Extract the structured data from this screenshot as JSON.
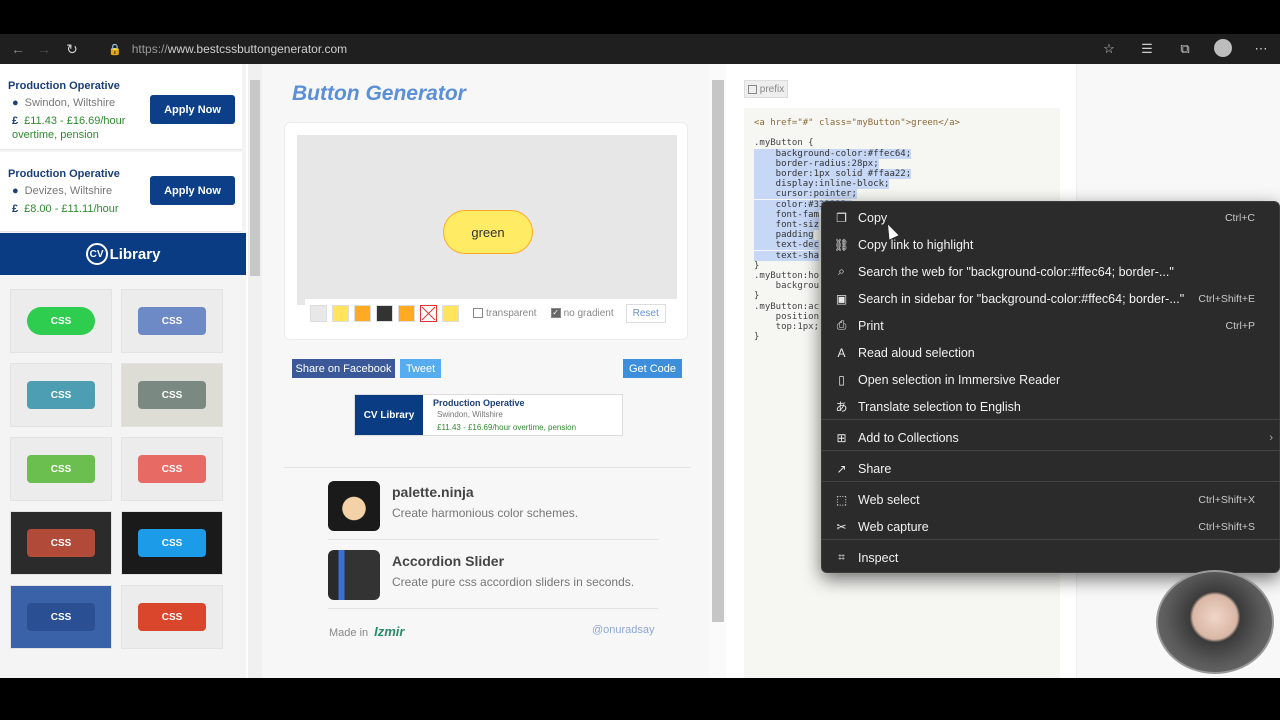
{
  "browser": {
    "url_protocol": "https://",
    "url_host": "www.bestcssbuttongenerator.com"
  },
  "left_ads": {
    "jobs": [
      {
        "title": "Production Operative",
        "location": "Swindon, Wiltshire",
        "pay": "£11.43 - £16.69/hour overtime, pension",
        "button": "Apply Now"
      },
      {
        "title": "Production Operative",
        "location": "Devizes, Wiltshire",
        "pay": "£8.00 - £11.11/hour",
        "button": "Apply Now"
      }
    ],
    "brand": "Library",
    "brand_mark": "CV",
    "swatches": [
      {
        "label": "CSS",
        "bg": "#2ecc4f",
        "tile": "#ececec"
      },
      {
        "label": "CSS",
        "bg": "#6d89c6",
        "tile": "#ececec"
      },
      {
        "label": "CSS",
        "bg": "#4e9eb3",
        "tile": "#ececec"
      },
      {
        "label": "CSS",
        "bg": "#7a8a82",
        "tile": "#ddddd5"
      },
      {
        "label": "CSS",
        "bg": "#6bbf4e",
        "tile": "#ececec"
      },
      {
        "label": "CSS",
        "bg": "#e86a64",
        "tile": "#ececec"
      },
      {
        "label": "CSS",
        "bg": "#b24a3a",
        "tile": "#2b2b2b"
      },
      {
        "label": "CSS",
        "bg": "#1c9ce8",
        "tile": "#1a1a1a"
      },
      {
        "label": "CSS",
        "bg": "#2b4f93",
        "tile": "#3a62a8"
      },
      {
        "label": "CSS",
        "bg": "#d9462b",
        "tile": "#ececec"
      }
    ]
  },
  "generator": {
    "title": "Button Generator",
    "preview_button_label": "green",
    "palette_colors": [
      "#e8e8e8",
      "#ffe45c",
      "#ffaa22",
      "#333333",
      "#ffaa22",
      "#ffffff",
      "#ffe45c"
    ],
    "transparent_label": "transparent",
    "no_gradient_label": "no gradient",
    "reset_label": "Reset",
    "share_facebook": "Share on Facebook",
    "tweet": "Tweet",
    "get_code": "Get Code",
    "mini_ad": {
      "title": "Production Operative",
      "location": "Swindon, Wiltshire",
      "pay": "£11.43 - £16.69/hour overtime, pension"
    },
    "promos": [
      {
        "title": "palette.ninja",
        "desc": "Create harmonious color schemes."
      },
      {
        "title": "Accordion Slider",
        "desc": "Create pure css accordion sliders in seconds."
      }
    ],
    "made_in": "Made in",
    "made_brand": "Izmir",
    "handle": "@onuradsay"
  },
  "code_panel": {
    "prefix_label": "prefix",
    "lines": [
      "<a href=\"#\" class=\"myButton\">green</a>",
      "",
      ".myButton {",
      "    background-color:#ffec64;",
      "    border-radius:28px;",
      "    border:1px solid #ffaa22;",
      "    display:inline-block;",
      "    cursor:pointer;",
      "    color:#333333;",
      "    font-fam",
      "    font-siz",
      "    padding",
      "    text-dec",
      "    text-sha",
      "}",
      ".myButton:ho",
      "    backgrou",
      "}",
      ".myButton:ac",
      "    position",
      "    top:1px;",
      "}"
    ]
  },
  "context_menu": {
    "items": [
      {
        "icon": "copy-icon",
        "label": "Copy",
        "shortcut": "Ctrl+C"
      },
      {
        "icon": "link-highlight-icon",
        "label": "Copy link to highlight",
        "shortcut": ""
      },
      {
        "icon": "search-icon",
        "label": "Search the web for \"background-color:#ffec64;  border-...\"",
        "shortcut": ""
      },
      {
        "icon": "sidebar-search-icon",
        "label": "Search in sidebar for \"background-color:#ffec64;  border-...\"",
        "shortcut": "Ctrl+Shift+E"
      },
      {
        "icon": "print-icon",
        "label": "Print",
        "shortcut": "Ctrl+P"
      },
      {
        "icon": "read-aloud-icon",
        "label": "Read aloud selection",
        "shortcut": ""
      },
      {
        "icon": "immersive-reader-icon",
        "label": "Open selection in Immersive Reader",
        "shortcut": ""
      },
      {
        "icon": "translate-icon",
        "label": "Translate selection to English",
        "shortcut": ""
      },
      {
        "icon": "collections-icon",
        "label": "Add to Collections",
        "shortcut": ""
      },
      {
        "icon": "share-icon",
        "label": "Share",
        "shortcut": ""
      },
      {
        "icon": "web-select-icon",
        "label": "Web select",
        "shortcut": "Ctrl+Shift+X"
      },
      {
        "icon": "web-capture-icon",
        "label": "Web capture",
        "shortcut": "Ctrl+Shift+S"
      },
      {
        "icon": "inspect-icon",
        "label": "Inspect",
        "shortcut": ""
      }
    ]
  }
}
